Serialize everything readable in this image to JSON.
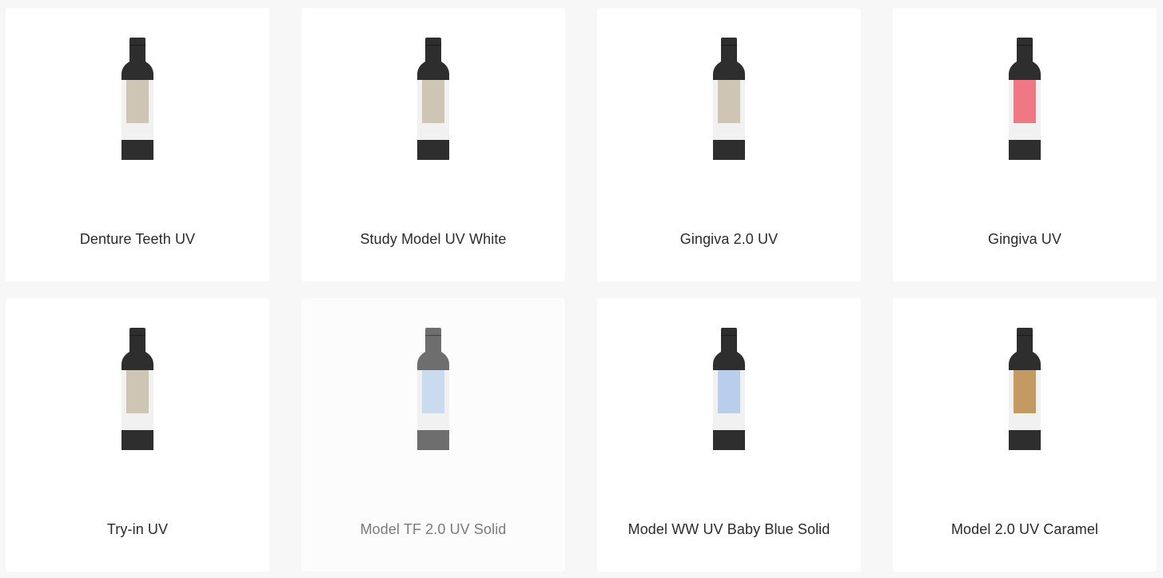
{
  "products": [
    {
      "name": "Denture Teeth UV",
      "resin_color": "#cfc5b4",
      "bottle_color": "#2e2e2e",
      "dimmed": false
    },
    {
      "name": "Study Model UV White",
      "resin_color": "#cfc5b4",
      "bottle_color": "#2e2e2e",
      "dimmed": false
    },
    {
      "name": "Gingiva 2.0 UV",
      "resin_color": "#cfc5b4",
      "bottle_color": "#2e2e2e",
      "dimmed": false
    },
    {
      "name": "Gingiva UV",
      "resin_color": "#f07784",
      "bottle_color": "#2e2e2e",
      "dimmed": false
    },
    {
      "name": "Try-in UV",
      "resin_color": "#cfc5b4",
      "bottle_color": "#2e2e2e",
      "dimmed": false
    },
    {
      "name": "Model TF 2.0 UV Solid",
      "resin_color": "#cadbef",
      "bottle_color": "#6e6e6e",
      "dimmed": true
    },
    {
      "name": "Model WW UV Baby Blue Solid",
      "resin_color": "#b8ceeb",
      "bottle_color": "#2e2e2e",
      "dimmed": false
    },
    {
      "name": "Model 2.0 UV Caramel",
      "resin_color": "#c49a63",
      "bottle_color": "#2e2e2e",
      "dimmed": false
    }
  ],
  "colors": {
    "page_background": "#f7f7f7",
    "card_background": "#ffffff",
    "bottle_label_band": "#f1f1f1"
  },
  "icon": "resin-bottle-icon"
}
